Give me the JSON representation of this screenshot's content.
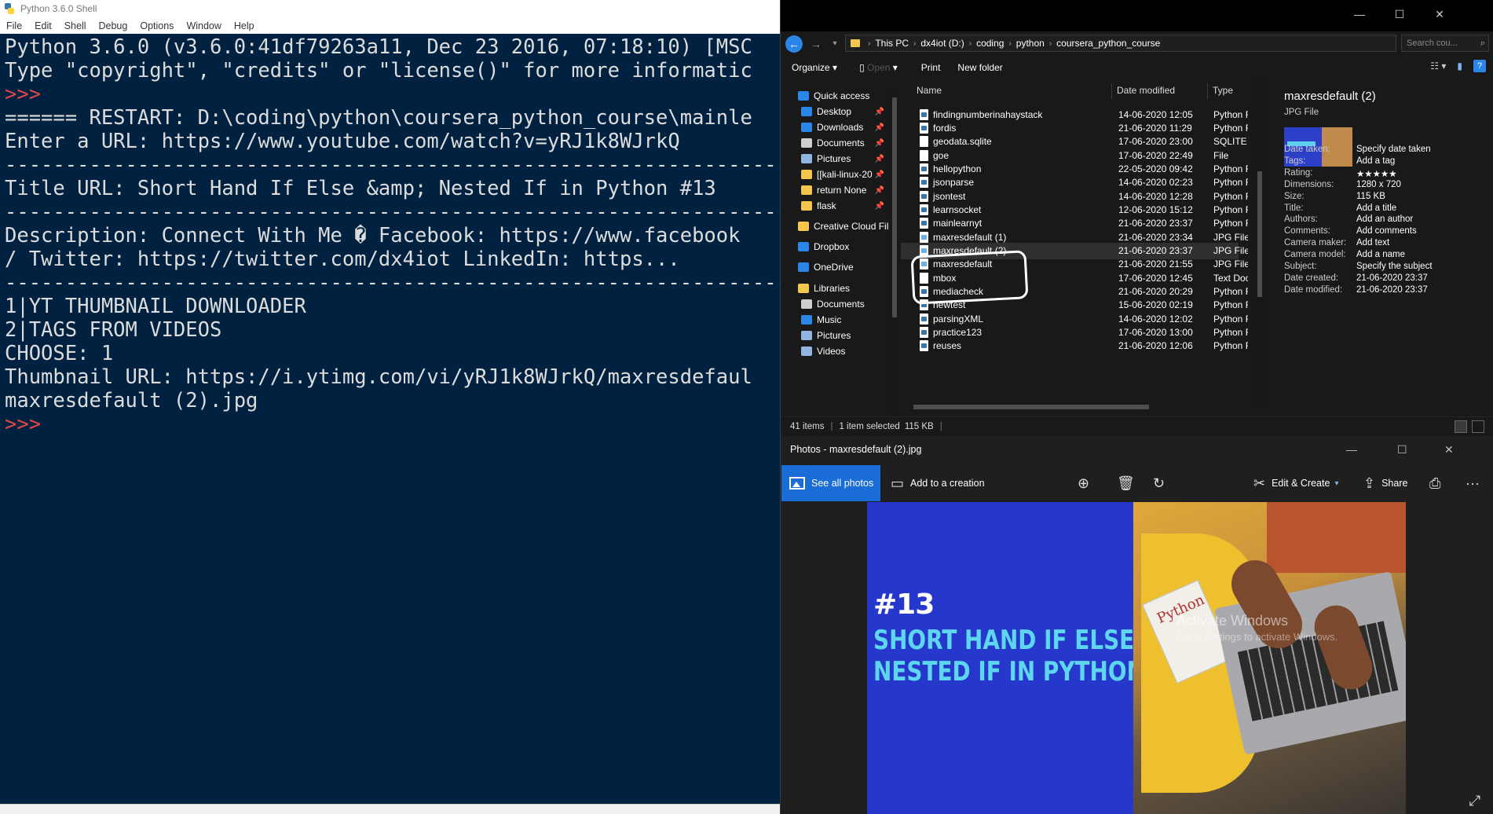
{
  "idle": {
    "title": "Python 3.6.0 Shell",
    "menu": [
      "File",
      "Edit",
      "Shell",
      "Debug",
      "Options",
      "Window",
      "Help"
    ],
    "lines": [
      {
        "text": "Python 3.6.0 (v3.6.0:41df79263a11, Dec 23 2016, 07:18:10) [MSC",
        "prompt": false
      },
      {
        "text": "Type \"copyright\", \"credits\" or \"license()\" for more informatic",
        "prompt": false
      },
      {
        "text": ">>>",
        "prompt": true
      },
      {
        "text": "====== RESTART: D:\\coding\\python\\coursera_python_course\\mainle",
        "prompt": false
      },
      {
        "text": "Enter a URL: https://www.youtube.com/watch?v=yRJ1k8WJrkQ",
        "prompt": false
      },
      {
        "text": "-----------------------------------------------------------------",
        "prompt": false
      },
      {
        "text": "Title URL: Short Hand If Else &amp; Nested If in Python #13",
        "prompt": false
      },
      {
        "text": "-----------------------------------------------------------------",
        "prompt": false
      },
      {
        "text": "Description: Connect With Me � Facebook: https://www.facebook",
        "prompt": false
      },
      {
        "text": "/ Twitter: https://twitter.com/dx4iot LinkedIn: https...",
        "prompt": false
      },
      {
        "text": "-----------------------------------------------------------------",
        "prompt": false
      },
      {
        "text": "1|YT THUMBNAIL DOWNLOADER",
        "prompt": false
      },
      {
        "text": "2|TAGS FROM VIDEOS",
        "prompt": false
      },
      {
        "text": "CHOOSE: 1",
        "prompt": false
      },
      {
        "text": "Thumbnail URL: https://i.ytimg.com/vi/yRJ1k8WJrkQ/maxresdefaul",
        "prompt": false
      },
      {
        "text": "maxresdefault (2).jpg",
        "prompt": false
      },
      {
        "text": ">>>",
        "prompt": true
      }
    ]
  },
  "explorer": {
    "window_controls": [
      "—",
      "☐",
      "✕"
    ],
    "breadcrumb": [
      "This PC",
      "dx4iot (D:)",
      "coding",
      "python",
      "coursera_python_course"
    ],
    "search_placeholder": "Search cou...",
    "toolbar": {
      "organize": "Organize",
      "open": "Open",
      "print": "Print",
      "new_folder": "New folder"
    },
    "nav_items": [
      {
        "label": "Quick access",
        "icon": "star-icon",
        "color": "#2b86e8",
        "pinned": false
      },
      {
        "label": "Desktop",
        "icon": "desktop-icon",
        "color": "#2b86e8",
        "pinned": true
      },
      {
        "label": "Downloads",
        "icon": "download-icon",
        "color": "#2b86e8",
        "pinned": true
      },
      {
        "label": "Documents",
        "icon": "documents-icon",
        "color": "#cfcfcf",
        "pinned": true
      },
      {
        "label": "Pictures",
        "icon": "pictures-icon",
        "color": "#8fb5e0",
        "pinned": true
      },
      {
        "label": "[[kali-linux-20",
        "icon": "folder-icon",
        "color": "#f3c74e",
        "pinned": true
      },
      {
        "label": "return None",
        "icon": "folder-icon",
        "color": "#f3c74e",
        "pinned": true
      },
      {
        "label": "flask",
        "icon": "folder-icon",
        "color": "#f3c74e",
        "pinned": true
      },
      {
        "label": "Creative Cloud File",
        "icon": "creative-cloud-icon",
        "color": "#f3c74e",
        "pinned": false
      },
      {
        "label": "Dropbox",
        "icon": "dropbox-icon",
        "color": "#2b86e8",
        "pinned": false
      },
      {
        "label": "OneDrive",
        "icon": "onedrive-icon",
        "color": "#2b86e8",
        "pinned": false
      },
      {
        "label": "Libraries",
        "icon": "libraries-icon",
        "color": "#f3c74e",
        "pinned": false
      },
      {
        "label": "Documents",
        "icon": "documents-icon",
        "color": "#cfcfcf",
        "pinned": false
      },
      {
        "label": "Music",
        "icon": "music-icon",
        "color": "#2b86e8",
        "pinned": false
      },
      {
        "label": "Pictures",
        "icon": "pictures-icon",
        "color": "#8fb5e0",
        "pinned": false
      },
      {
        "label": "Videos",
        "icon": "videos-icon",
        "color": "#8fb5e0",
        "pinned": false
      }
    ],
    "columns": {
      "name": "Name",
      "date": "Date modified",
      "type": "Type"
    },
    "files": [
      {
        "name": "findingnumberinahaystack",
        "date": "14-06-2020 12:05",
        "type": "Python F",
        "kind": "py"
      },
      {
        "name": "fordis",
        "date": "21-06-2020 11:29",
        "type": "Python F",
        "kind": "py"
      },
      {
        "name": "geodata.sqlite",
        "date": "17-06-2020 23:00",
        "type": "SQLITE F",
        "kind": "file"
      },
      {
        "name": "goe",
        "date": "17-06-2020 22:49",
        "type": "File",
        "kind": "file"
      },
      {
        "name": "hellopython",
        "date": "22-05-2020 09:42",
        "type": "Python F",
        "kind": "py"
      },
      {
        "name": "jsonparse",
        "date": "14-06-2020 02:23",
        "type": "Python F",
        "kind": "py"
      },
      {
        "name": "jsontest",
        "date": "14-06-2020 12:28",
        "type": "Python F",
        "kind": "py"
      },
      {
        "name": "learnsocket",
        "date": "12-06-2020 15:12",
        "type": "Python F",
        "kind": "py"
      },
      {
        "name": "mainlearnyt",
        "date": "21-06-2020 23:37",
        "type": "Python F",
        "kind": "py"
      },
      {
        "name": "maxresdefault (1)",
        "date": "21-06-2020 23:34",
        "type": "JPG File",
        "kind": "jpg"
      },
      {
        "name": "maxresdefault (2)",
        "date": "21-06-2020 23:37",
        "type": "JPG File",
        "kind": "jpg",
        "selected": true
      },
      {
        "name": "maxresdefault",
        "date": "21-06-2020 21:55",
        "type": "JPG File",
        "kind": "jpg"
      },
      {
        "name": "mbox",
        "date": "17-06-2020 12:45",
        "type": "Text Doc",
        "kind": "file"
      },
      {
        "name": "mediacheck",
        "date": "21-06-2020 20:29",
        "type": "Python F",
        "kind": "py"
      },
      {
        "name": "newtest",
        "date": "15-06-2020 02:19",
        "type": "Python F",
        "kind": "py"
      },
      {
        "name": "parsingXML",
        "date": "14-06-2020 12:02",
        "type": "Python F",
        "kind": "py"
      },
      {
        "name": "practice123",
        "date": "17-06-2020 13:00",
        "type": "Python F",
        "kind": "py"
      },
      {
        "name": "reuses",
        "date": "21-06-2020 12:06",
        "type": "Python F",
        "kind": "py"
      }
    ],
    "details": {
      "name": "maxresdefault (2)",
      "type": "JPG File",
      "props": [
        {
          "k": "Date taken:",
          "v": "Specify date taken"
        },
        {
          "k": "Tags:",
          "v": "Add a tag"
        },
        {
          "k": "Rating:",
          "v": "★★★★★"
        },
        {
          "k": "Dimensions:",
          "v": "1280 x 720"
        },
        {
          "k": "Size:",
          "v": "115 KB"
        },
        {
          "k": "Title:",
          "v": "Add a title"
        },
        {
          "k": "Authors:",
          "v": "Add an author"
        },
        {
          "k": "Comments:",
          "v": "Add comments"
        },
        {
          "k": "Camera maker:",
          "v": "Add text"
        },
        {
          "k": "Camera model:",
          "v": "Add a name"
        },
        {
          "k": "Subject:",
          "v": "Specify the subject"
        },
        {
          "k": "Date created:",
          "v": "21-06-2020 23:37"
        },
        {
          "k": "Date modified:",
          "v": "21-06-2020 23:37"
        }
      ]
    },
    "status": {
      "count": "41 items",
      "selected": "1 item selected",
      "size": "115 KB"
    }
  },
  "photos": {
    "title": "Photos - maxresdefault (2).jpg",
    "window_controls": [
      "—",
      "☐",
      "✕"
    ],
    "see_all": "See all photos",
    "add_creation": "Add to a creation",
    "edit_create": "Edit & Create",
    "share": "Share",
    "image": {
      "number": "#13",
      "caption_line1": "SHORT HAND IF ELSE &",
      "caption_line2": "NESTED IF IN PYTHON",
      "book_title": "Python"
    },
    "watermark_title": "Activate Windows",
    "watermark_sub": "Go to Settings to activate Windows."
  }
}
